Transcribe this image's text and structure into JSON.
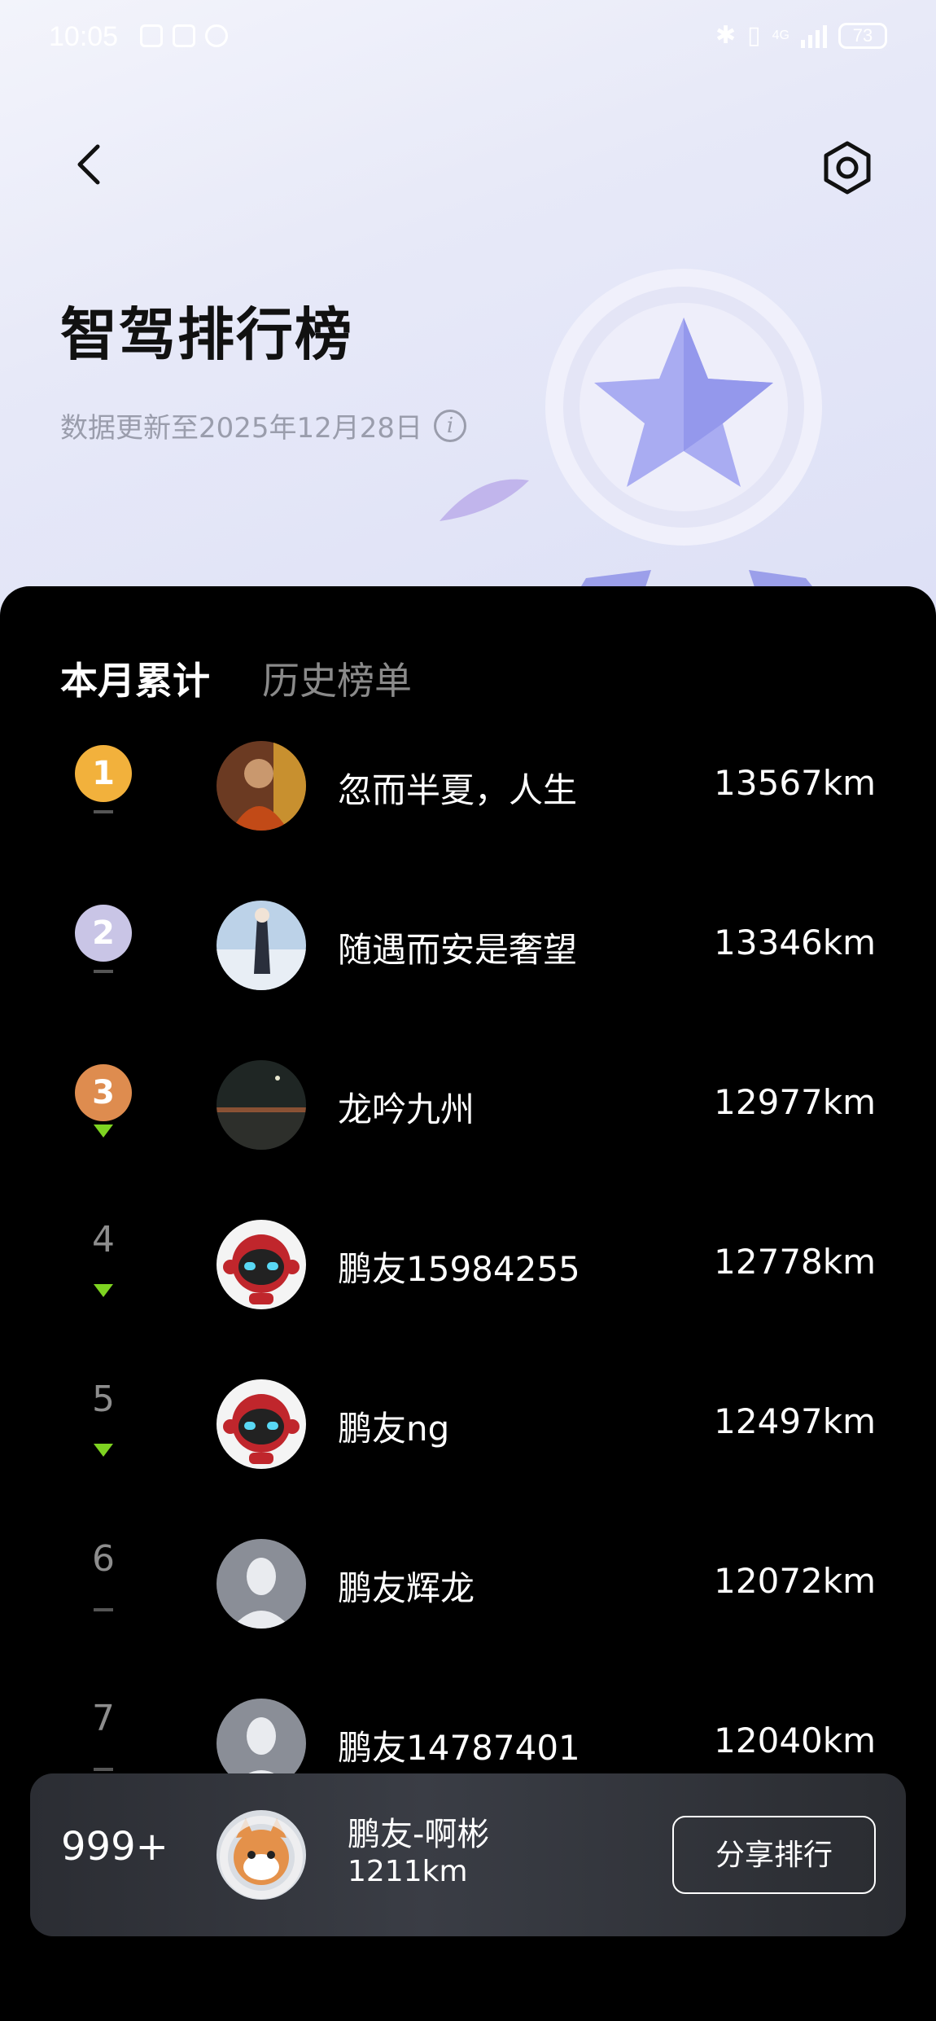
{
  "status_bar": {
    "time": "10:05",
    "battery": "73",
    "network": "4G"
  },
  "header": {
    "title": "智驾排行榜",
    "subtitle": "数据更新至2025年12月28日",
    "info_glyph": "i"
  },
  "tabs": [
    {
      "label": "本月累计",
      "active": true
    },
    {
      "label": "历史榜单",
      "active": false
    }
  ],
  "leaderboard": [
    {
      "rank": "1",
      "name": "忽而半夏，人生",
      "distance": "13567km",
      "trend": "flat",
      "badge_color": "#f2b13c",
      "avatar": "monk-photo"
    },
    {
      "rank": "2",
      "name": "随遇而安是奢望",
      "distance": "13346km",
      "trend": "flat",
      "badge_color": "#c9c5e6",
      "avatar": "anime-photo"
    },
    {
      "rank": "3",
      "name": "龙吟九州",
      "distance": "12977km",
      "trend": "down",
      "badge_color": "#de8c4f",
      "avatar": "night-photo"
    },
    {
      "rank": "4",
      "name": "鹏友15984255",
      "distance": "12778km",
      "trend": "down",
      "avatar": "robot-avatar"
    },
    {
      "rank": "5",
      "name": "鹏友ng",
      "distance": "12497km",
      "trend": "down",
      "avatar": "robot-avatar"
    },
    {
      "rank": "6",
      "name": "鹏友辉龙",
      "distance": "12072km",
      "trend": "flat",
      "avatar": "default-avatar"
    },
    {
      "rank": "7",
      "name": "鹏友14787401",
      "distance": "12040km",
      "trend": "flat",
      "avatar": "default-avatar"
    }
  ],
  "my_rank": {
    "rank": "999+",
    "name": "鹏友-啊彬",
    "distance": "1211km",
    "share_label": "分享排行"
  },
  "colors": {
    "accent_down": "#7ed321",
    "hero_bg": "#e7e9f8",
    "panel_bg": "#000000"
  }
}
